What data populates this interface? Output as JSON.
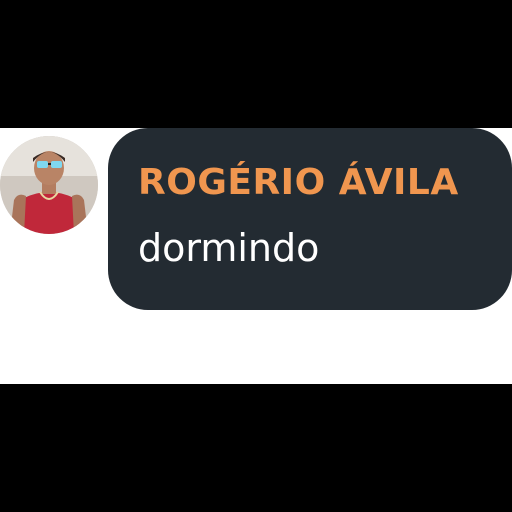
{
  "contact": {
    "name": "ROGÉRIO ÁVILA",
    "status": "dormindo"
  },
  "colors": {
    "bubble_background": "#232b32",
    "name_color": "#f0964f",
    "status_color": "#ffffff",
    "page_background": "#000000",
    "card_background": "#ffffff"
  },
  "icons": {
    "avatar": "profile-photo"
  }
}
